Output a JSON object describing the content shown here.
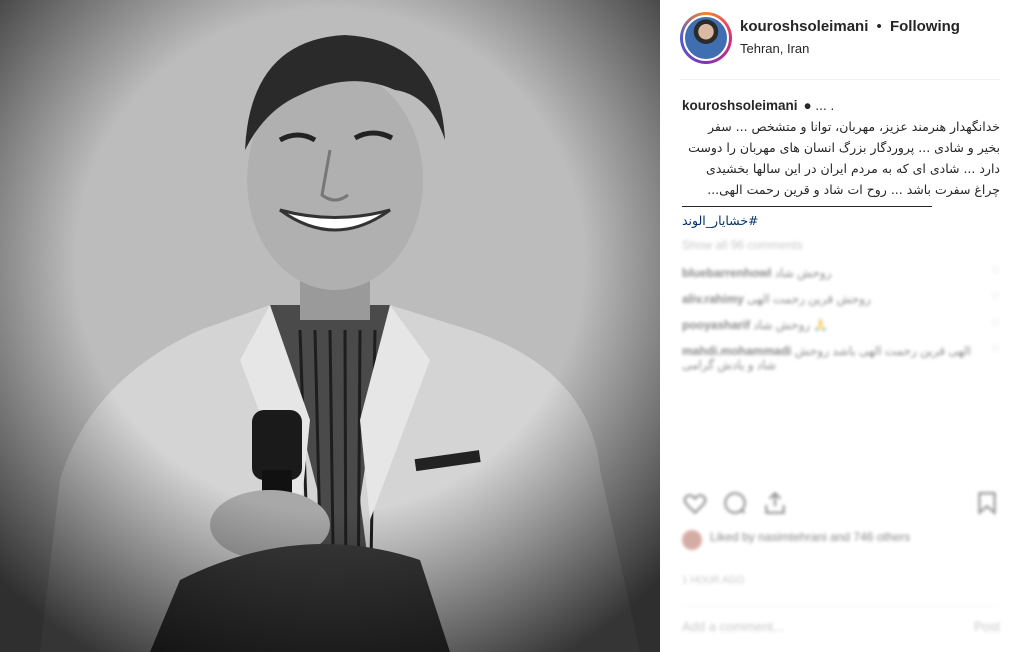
{
  "header": {
    "username": "kouroshsoleimani",
    "separator": "•",
    "follow_status": "Following",
    "location": "Tehran, Iran"
  },
  "caption": {
    "username": "kouroshsoleimani",
    "lead": "● ... .",
    "lines": [
      "خدانگهدار هنرمند عزیز، مهربان، توانا و متشخص ... سفر",
      "بخیر و شادی ... پروردگار بزرگ انسان های مهربان را دوست",
      "دارد ... شادی ای که به مردم ایران در این سالها بخشیدی",
      "چراغ سفرت باشد ... روح ات شاد و قرین رحمت الهی..."
    ],
    "hashtag": "#خشایار_الوند"
  },
  "comments": {
    "load_more": "Show all 96 comments",
    "items": [
      {
        "user": "bluebarrenhowl",
        "text": "روحش شاد"
      },
      {
        "user": "aliv.rahimy",
        "text": "روحش قرین رحمت الهی"
      },
      {
        "user": "pooyasharif",
        "text": "روحش شاد 🙏"
      },
      {
        "user": "mahdi.mohammadi",
        "text": "الهی قرین رحمت الهی باشد روحش شاد و یادش گرامی"
      }
    ]
  },
  "likes": {
    "text": "Liked by nasimtehrani and 746 others"
  },
  "time": "1 HOUR AGO",
  "add_comment": {
    "placeholder": "Add a comment...",
    "post_label": "Post"
  }
}
